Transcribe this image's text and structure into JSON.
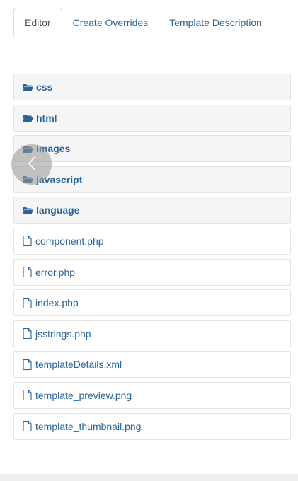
{
  "tabs": [
    {
      "label": "Editor",
      "active": true
    },
    {
      "label": "Create Overrides",
      "active": false
    },
    {
      "label": "Template Description",
      "active": false
    }
  ],
  "folders": [
    {
      "label": "css",
      "icon": "folder-open-icon"
    },
    {
      "label": "html",
      "icon": "folder-open-icon"
    },
    {
      "label": "images",
      "icon": "folder-open-icon"
    },
    {
      "label": "javascript",
      "icon": "folder-open-icon"
    },
    {
      "label": "language",
      "icon": "folder-open-icon"
    }
  ],
  "files": [
    {
      "label": "component.php",
      "icon": "file-icon"
    },
    {
      "label": "error.php",
      "icon": "file-icon"
    },
    {
      "label": "index.php",
      "icon": "file-icon"
    },
    {
      "label": "jsstrings.php",
      "icon": "file-icon"
    },
    {
      "label": "templateDetails.xml",
      "icon": "file-icon"
    },
    {
      "label": "template_preview.png",
      "icon": "file-icon"
    },
    {
      "label": "template_thumbnail.png",
      "icon": "file-icon"
    }
  ],
  "overlay": {
    "icon": "chevron-left-icon"
  },
  "colors": {
    "link": "#2a6496",
    "folder_bg": "#f5f5f5",
    "border": "#e3e3e3"
  }
}
